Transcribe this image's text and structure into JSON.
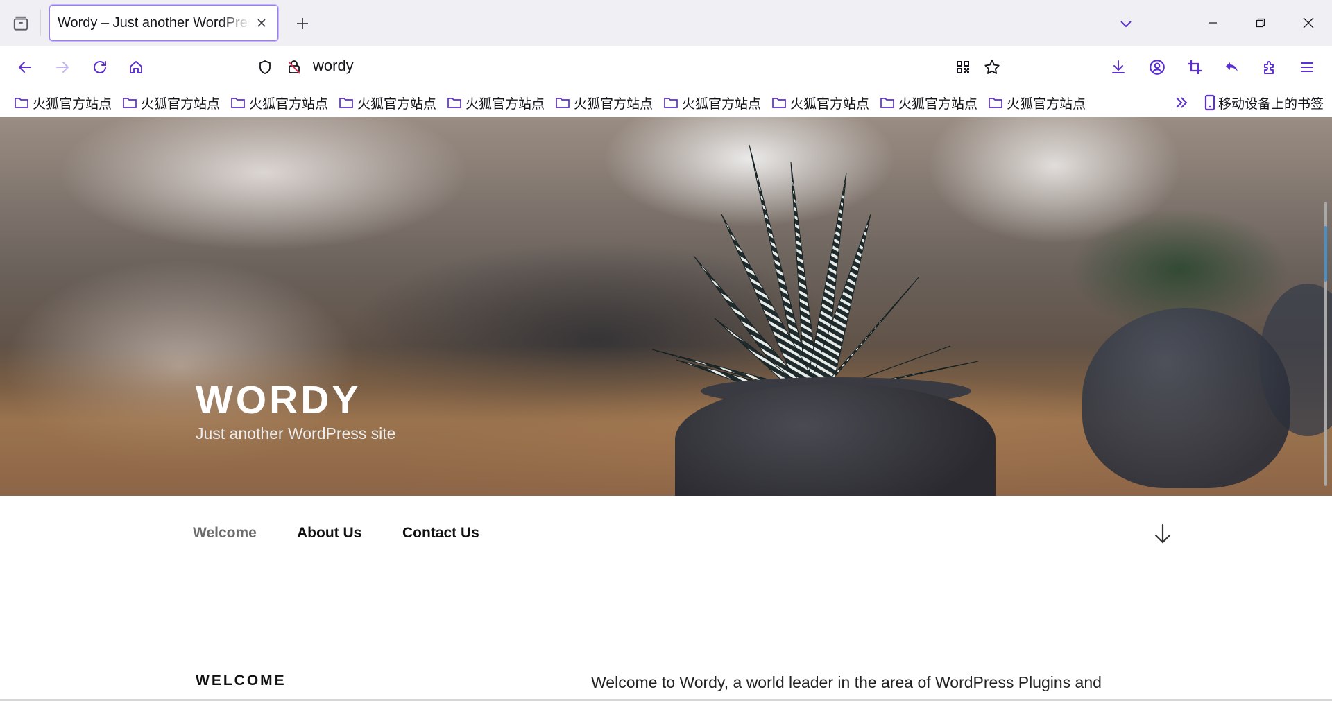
{
  "browser": {
    "tab": {
      "title": "Wordy – Just another WordPress site"
    },
    "address_bar": {
      "url": "wordy"
    },
    "bookmarks": [
      {
        "label": "火狐官方站点"
      },
      {
        "label": "火狐官方站点"
      },
      {
        "label": "火狐官方站点"
      },
      {
        "label": "火狐官方站点"
      },
      {
        "label": "火狐官方站点"
      },
      {
        "label": "火狐官方站点"
      },
      {
        "label": "火狐官方站点"
      },
      {
        "label": "火狐官方站点"
      },
      {
        "label": "火狐官方站点"
      },
      {
        "label": "火狐官方站点"
      }
    ],
    "mobile_bookmarks": "移动设备上的书签",
    "accent_color": "#7542e5",
    "icons": [
      "tab-manager-icon",
      "new-tab-icon",
      "tab-list-icon",
      "minimize-icon",
      "restore-icon",
      "close-icon",
      "back-icon",
      "forward-icon",
      "reload-icon",
      "home-icon",
      "shield-icon",
      "insecure-lock-icon",
      "qr-code-icon",
      "star-icon",
      "download-icon",
      "account-icon",
      "crop-icon",
      "undo-icon",
      "extensions-icon",
      "menu-icon",
      "folder-icon",
      "chevrons-right-icon",
      "mobile-icon"
    ]
  },
  "site": {
    "title": "WORDY",
    "tagline": "Just another WordPress site",
    "menu": [
      {
        "label": "Welcome",
        "current": true
      },
      {
        "label": "About Us",
        "current": false
      },
      {
        "label": "Contact Us",
        "current": false
      }
    ],
    "section_label": "WELCOME",
    "intro_text": "Welcome to Wordy, a world leader in the area of WordPress Plugins and"
  }
}
